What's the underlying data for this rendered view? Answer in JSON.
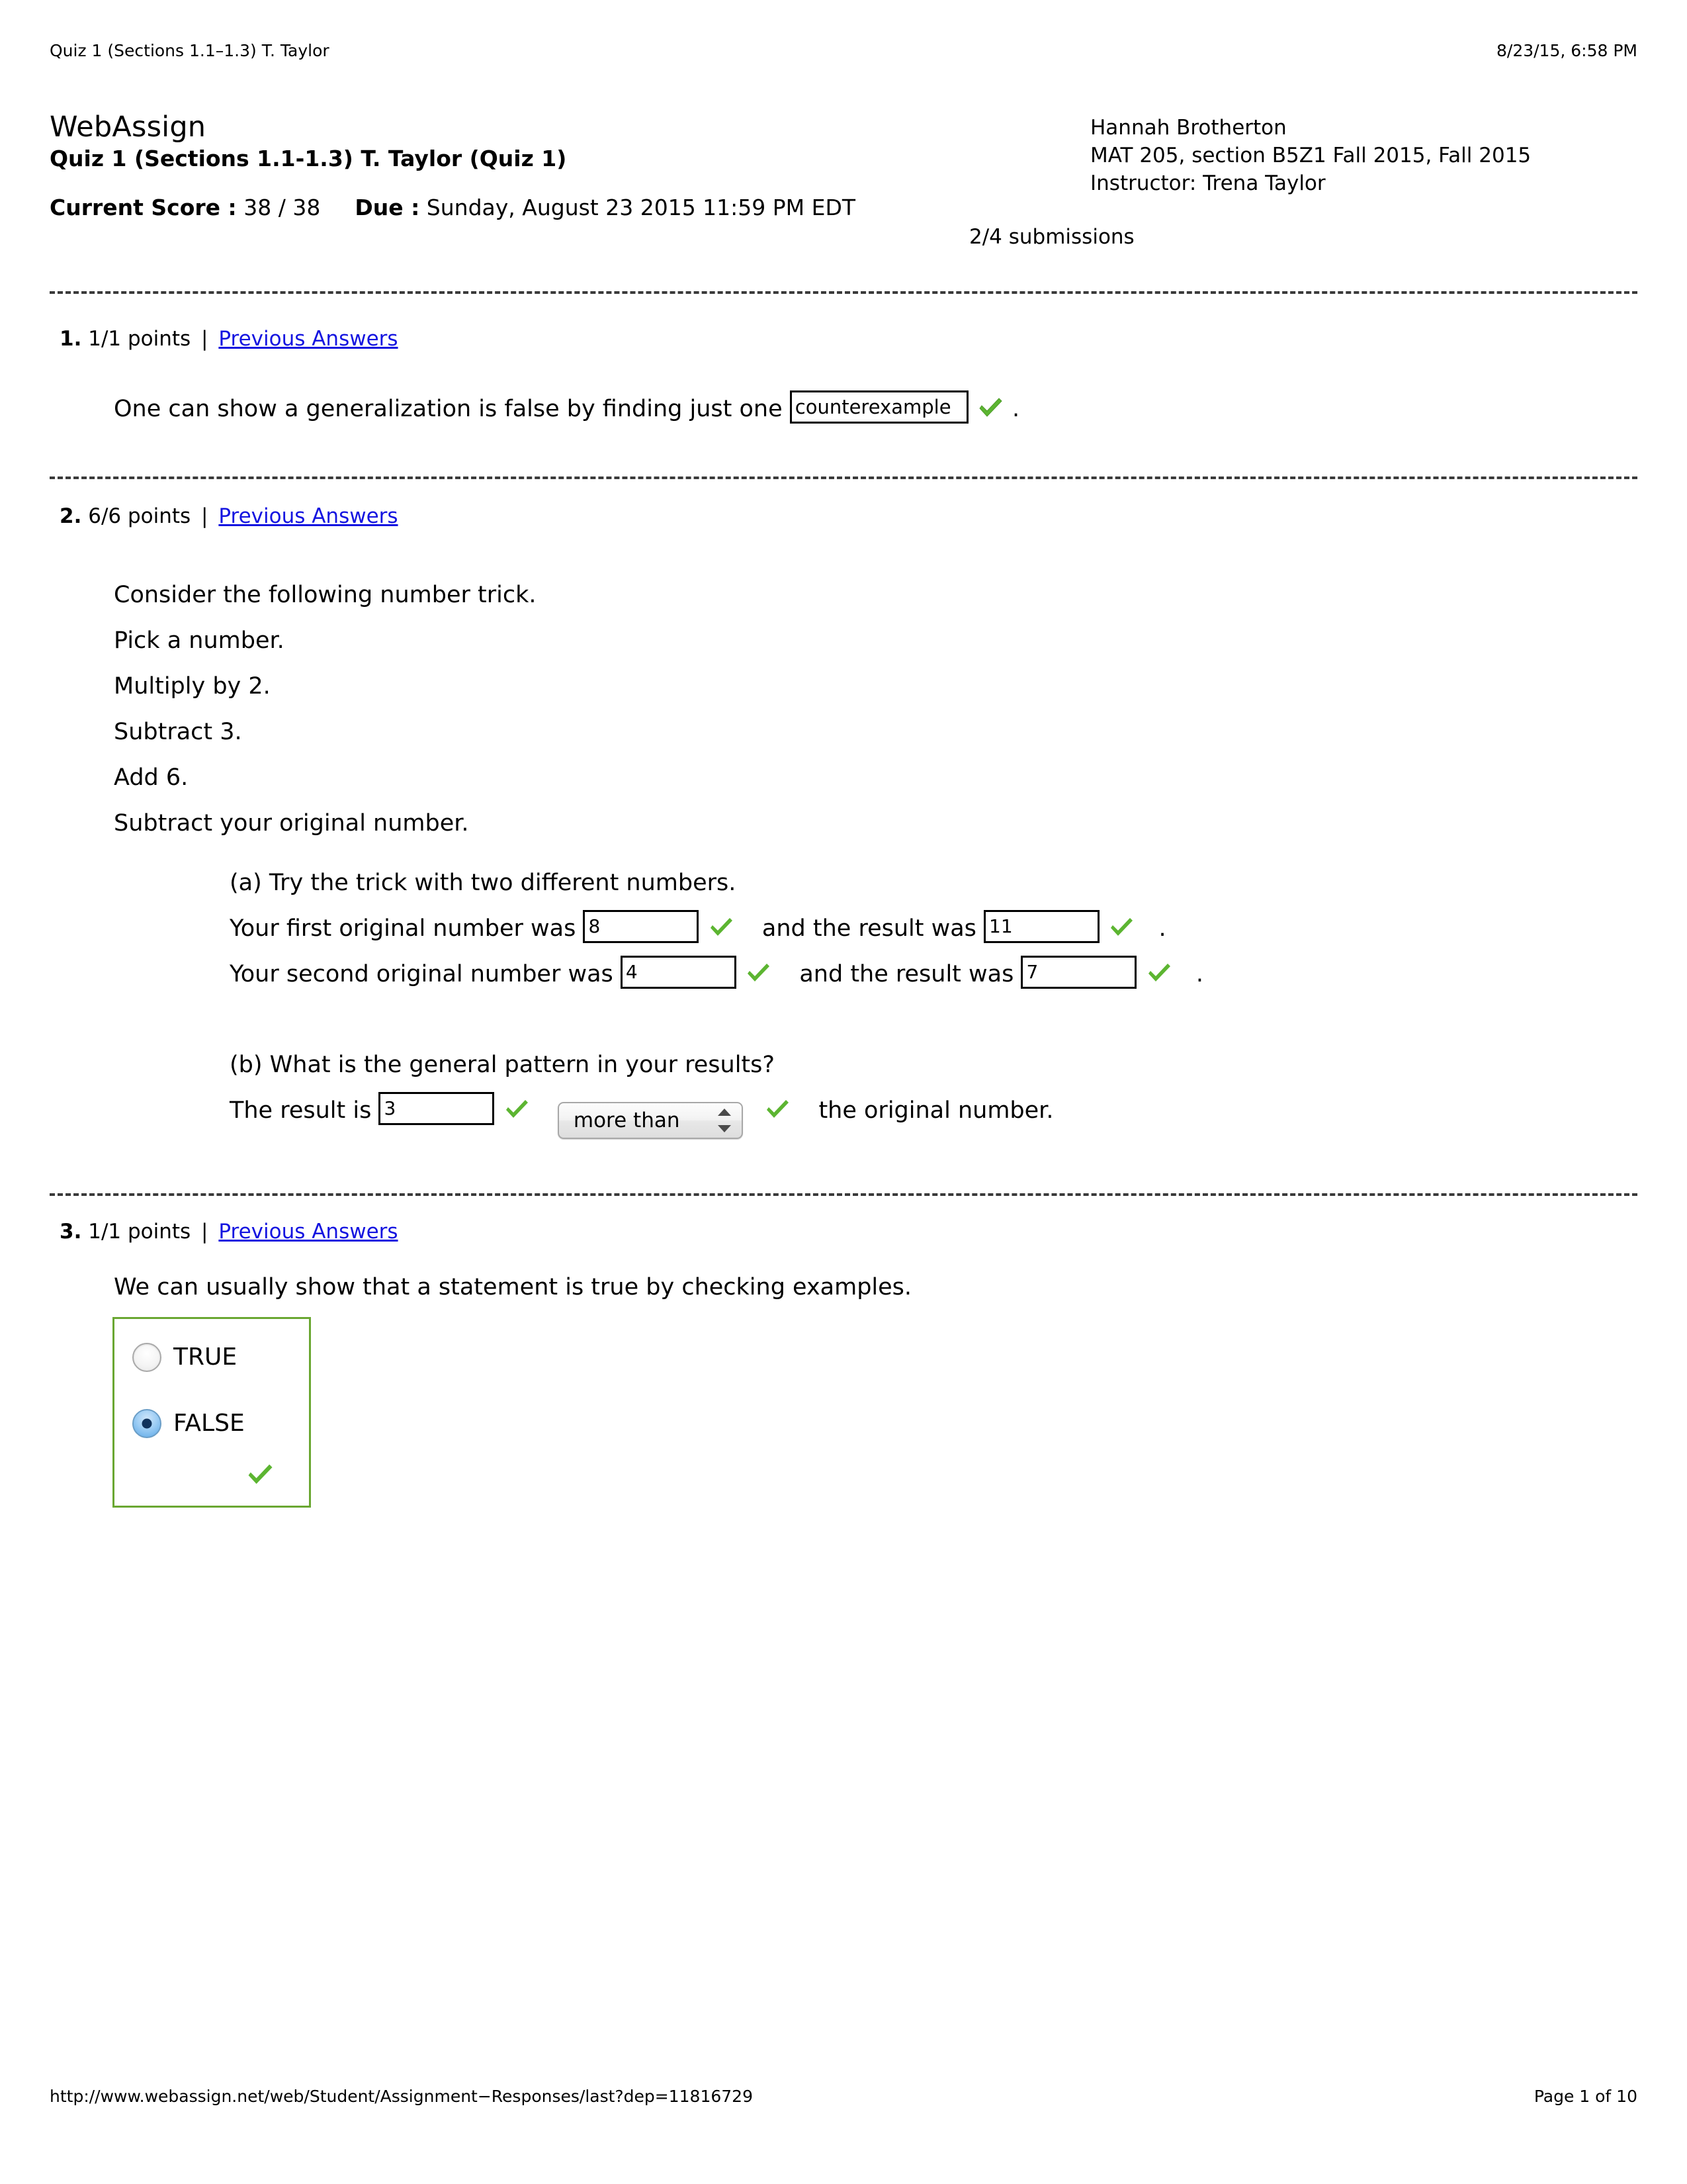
{
  "print_header": {
    "left": "Quiz 1 (Sections 1.1–1.3) T. Taylor",
    "right": "8/23/15, 6:58 PM"
  },
  "masthead": {
    "brand": "WebAssign",
    "assignment_title": "Quiz 1 (Sections 1.1-1.3) T. Taylor (Quiz 1)",
    "current_score_label": "Current Score :",
    "current_score_value": "38 / 38",
    "due_label": "Due :",
    "due_value": "Sunday, August 23 2015 11:59 PM EDT",
    "submissions": "2/4 submissions"
  },
  "student": {
    "name": "Hannah Brotherton",
    "course": "MAT 205, section B5Z1 Fall 2015, Fall 2015",
    "instructor": "Instructor: Trena Taylor"
  },
  "questions": [
    {
      "number": "1.",
      "points": "1/1 points",
      "divider": "|",
      "previous_answers": "Previous Answers",
      "prompt_before": "One can show a generalization is false by finding just one",
      "answer_value": "counterexample",
      "prompt_after": "."
    },
    {
      "number": "2.",
      "points": "6/6 points",
      "divider": "|",
      "previous_answers": "Previous Answers",
      "intro_lines": [
        "Consider the following number trick.",
        "Pick a number.",
        "Multiply by 2.",
        "Subtract 3.",
        "Add 6.",
        "Subtract your original number."
      ],
      "part_a": {
        "label": "(a) Try the trick with two different numbers.",
        "row1_prefix": "Your first original number was",
        "row1_value": "8",
        "row1_middle": "and the result was",
        "row1_result": "11",
        "row1_suffix": ".",
        "row2_prefix": "Your second original number was",
        "row2_value": "4",
        "row2_middle": "and the result was",
        "row2_result": "7",
        "row2_suffix": "."
      },
      "part_b": {
        "label": "(b) What is the general pattern in your results?",
        "row_prefix": "The result is",
        "row_value": "3",
        "select_value": "more than",
        "row_suffix": "the original number."
      }
    },
    {
      "number": "3.",
      "points": "1/1 points",
      "divider": "|",
      "previous_answers": "Previous Answers",
      "prompt": "We can usually show that a statement is true by checking examples.",
      "options": [
        {
          "label": "TRUE",
          "selected": false
        },
        {
          "label": "FALSE",
          "selected": true
        }
      ]
    }
  ],
  "print_footer": {
    "url": "http://www.webassign.net/web/Student/Assignment−Responses/last?dep=11816729",
    "page": "Page 1 of 10"
  },
  "colors": {
    "link": "#1414e0",
    "check_green": "#5cb531",
    "radio_box_border": "#6aa732",
    "separator": "#3a3a3a"
  },
  "icons": {
    "check": "check-icon",
    "stepper_up": "stepper-up-icon",
    "stepper_down": "stepper-down-icon"
  }
}
